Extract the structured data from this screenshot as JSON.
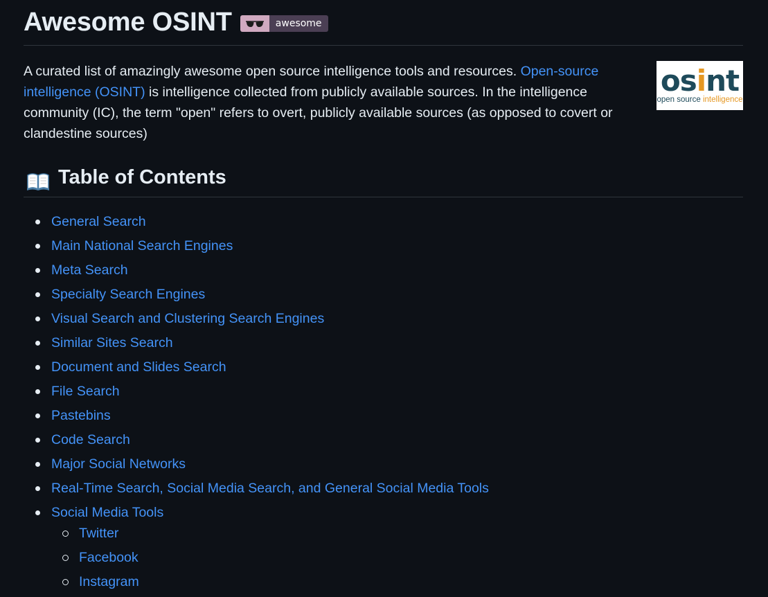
{
  "header": {
    "title": "Awesome OSINT",
    "badge_label": "awesome",
    "badge_icon": "sunglasses-icon"
  },
  "intro": {
    "text_before": "A curated list of amazingly awesome open source intelligence tools and resources. ",
    "link_text": "Open-source intelligence (OSINT)",
    "text_after": " is intelligence collected from publicly available sources. In the intelligence community (IC), the term \"open\" refers to overt, publicly available sources (as opposed to covert or clandestine sources)"
  },
  "logo": {
    "word_pre": "os",
    "word_i": "i",
    "word_post": "nt",
    "sub_pre": "open source ",
    "sub_intel": "intelligence",
    "colors": {
      "primary": "#1e4a5a",
      "accent": "#e59722"
    }
  },
  "toc": {
    "icon": "open-book-icon",
    "title": "Table of Contents",
    "items": [
      "General Search",
      "Main National Search Engines",
      "Meta Search",
      "Specialty Search Engines",
      "Visual Search and Clustering Search Engines",
      "Similar Sites Search",
      "Document and Slides Search",
      "File Search",
      "Pastebins",
      "Code Search",
      "Major Social Networks",
      "Real-Time Search, Social Media Search, and General Social Media Tools",
      "Social Media Tools"
    ],
    "sub_items": [
      "Twitter",
      "Facebook",
      "Instagram"
    ]
  },
  "colors": {
    "background": "#0d1117",
    "text": "#e6edf3",
    "link": "#4493f8",
    "divider": "#30363d"
  }
}
